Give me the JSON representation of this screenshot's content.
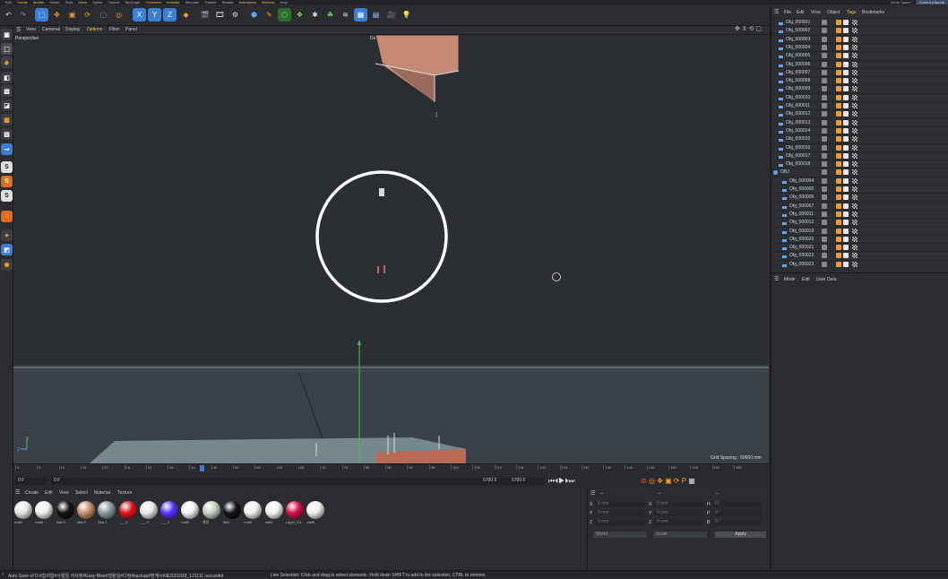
{
  "menubar": {
    "items": [
      {
        "label": "Edit",
        "hl": false
      },
      {
        "label": "Create",
        "hl": true
      },
      {
        "label": "Modes",
        "hl": true
      },
      {
        "label": "Select",
        "hl": false
      },
      {
        "label": "Tools",
        "hl": false
      },
      {
        "label": "Mesh",
        "hl": true
      },
      {
        "label": "Spline",
        "hl": false
      },
      {
        "label": "Volume",
        "hl": false
      },
      {
        "label": "MoGraph",
        "hl": false
      },
      {
        "label": "Character",
        "hl": true
      },
      {
        "label": "Animate",
        "hl": true
      },
      {
        "label": "Simulate",
        "hl": false
      },
      {
        "label": "Tracker",
        "hl": false
      },
      {
        "label": "Render",
        "hl": false
      },
      {
        "label": "Extensions",
        "hl": true
      },
      {
        "label": "Window",
        "hl": true
      },
      {
        "label": "Help",
        "hl": false
      }
    ],
    "node_space_label": "Node Space:",
    "node_space_value": "Current (Standa"
  },
  "viewport": {
    "menu": [
      "View",
      "Cameras",
      "Display",
      "Options",
      "Filter",
      "Panel"
    ],
    "view_name": "Perspective",
    "camera_name": "Default Camera",
    "grid_spacing": "Grid Spacing : 50000 mm"
  },
  "timeline": {
    "ticks": [
      "0",
      "5",
      "10",
      "15",
      "20",
      "25",
      "30",
      "35",
      "40",
      "45",
      "50",
      "55",
      "60",
      "65",
      "70",
      "75",
      "80",
      "85",
      "90",
      "95",
      "100",
      "105",
      "110",
      "115",
      "120",
      "125",
      "130",
      "135",
      "140",
      "145",
      "150",
      "155",
      "160",
      "165"
    ],
    "current_frame": "0 F",
    "start_field": "0 F",
    "end_frame": "6700 F",
    "end_field": "6700 F"
  },
  "material_manager": {
    "menu": [
      "Create",
      "Edit",
      "View",
      "Select",
      "Material",
      "Texture"
    ],
    "materials": [
      {
        "label": "mat0",
        "color": "#e6e6e6"
      },
      {
        "label": "mat0",
        "color": "#f0f0f0"
      },
      {
        "label": "Mat.5",
        "color": "#141414"
      },
      {
        "label": "Mat.2",
        "color": "#c58f72"
      },
      {
        "label": "Mat.1",
        "color": "#8f97a0"
      },
      {
        "label": "___ 0",
        "color": "#e0161e"
      },
      {
        "label": "___ 0",
        "color": "#e8e8e8"
      },
      {
        "label": "___ 0",
        "color": "#5a33ff"
      },
      {
        "label": "mat0",
        "color": "#f2f2f2"
      },
      {
        "label": "재질",
        "color": "#c6d0c0"
      },
      {
        "label": "Mat",
        "color": "#151515"
      },
      {
        "label": "mat0",
        "color": "#eeeeee"
      },
      {
        "label": "mat0",
        "color": "#f5f5f5"
      },
      {
        "label": "Layer_Ca",
        "color": "#d8104a"
      },
      {
        "label": "mat0",
        "color": "#eeeeee"
      }
    ]
  },
  "coordinates": {
    "header": [
      "--",
      "--",
      "--"
    ],
    "rows": [
      {
        "a": "X",
        "av": "0 mm",
        "b": "X",
        "bv": "0 mm",
        "c": "H",
        "cv": "0 °"
      },
      {
        "a": "Y",
        "av": "0 mm",
        "b": "Y",
        "bv": "0 mm",
        "c": "P",
        "cv": "0 °"
      },
      {
        "a": "Z",
        "av": "0 mm",
        "b": "Z",
        "bv": "0 mm",
        "c": "B",
        "cv": "0 °"
      }
    ],
    "space": "World",
    "mode": "Scale",
    "apply": "Apply"
  },
  "object_manager": {
    "menu": [
      "File",
      "Edit",
      "View",
      "Object",
      "Tags",
      "Bookmarks"
    ],
    "objects": [
      "Obj_000001",
      "Obj_000002",
      "Obj_000003",
      "Obj_000004",
      "Obj_000005",
      "Obj_000006",
      "Obj_000007",
      "Obj_000008",
      "Obj_000009",
      "Obj_000010",
      "Obj_000011",
      "Obj_000012",
      "Obj_000013",
      "Obj_000014",
      "Obj_000015",
      "Obj_000016",
      "Obj_000017",
      "Obj_000018"
    ],
    "group": "OBJ",
    "children": [
      "Obj_000004",
      "Obj_000005",
      "Obj_000006",
      "Obj_000007",
      "Obj_000011",
      "Obj_000012",
      "Obj_000019",
      "Obj_000020",
      "Obj_000021",
      "Obj_000022",
      "Obj_000023"
    ]
  },
  "attributes": {
    "menu": [
      "Mode",
      "Edit",
      "User Data"
    ]
  },
  "status": {
    "left": "Auto Save of D:#합의없#사찰일 지사정#Easy Bloe#형울일#다정#backup#편계시#효2021018_121111 succesful",
    "right": "Live Selection: Click and drag to select elements. Hold down SHIFT to add to the selection, CTRL to remove."
  },
  "colors": {
    "accent": "#5aa9ff",
    "y_axis": "#5cc05c",
    "selection": "#ffffff"
  }
}
